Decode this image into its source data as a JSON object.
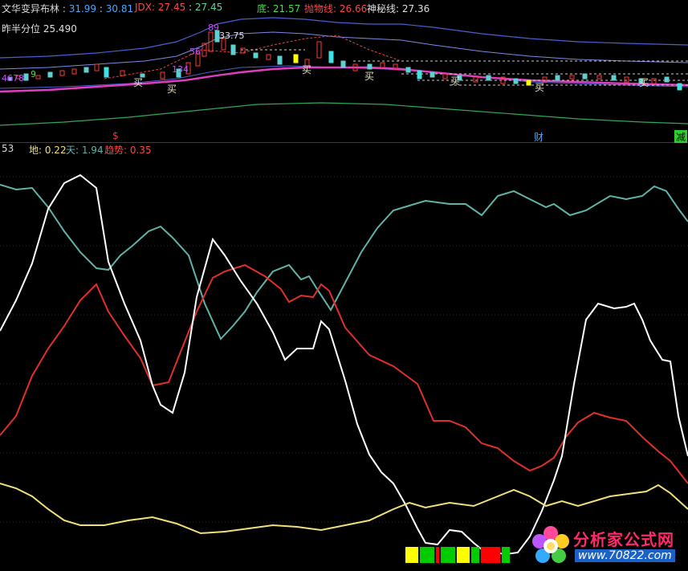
{
  "header": {
    "title": "文华变异布林",
    "v1": "31.99",
    "v2": "30.81",
    "jdx_label": "JDX: 27.45",
    "jdx_val": "27.45",
    "di_label": "底: 21.57",
    "pao_label": "抛物线: 26.66",
    "shen_label": "神秘线: 27.36"
  },
  "sub_header": {
    "zuoban_label": "昨半分位",
    "zuoban_value": "25.490"
  },
  "price_annotations": {
    "top_label_89": "89",
    "peak_price": "33.75",
    "label_56": "56",
    "label_134": "134",
    "left_seq": "4678",
    "left_9": "9",
    "buy": "买",
    "sell_dollar": "$",
    "cai": "财",
    "jian": "减"
  },
  "lower_header": {
    "left_num": "53",
    "di_label": "地: 0.22",
    "tian_label": "天: 1.94",
    "qushi_label": "趋势: 0.35"
  },
  "watermark": {
    "title": "分析家公式网",
    "url": "www.70822.com"
  },
  "colors": {
    "white_line": "#ffffff",
    "red_line": "#e8302a",
    "teal_line": "#5fb3a8",
    "yellow_line": "#f0e07a",
    "boll_upper": "#5a6fd8",
    "boll_mid": "#e03dbf",
    "green_line": "#2fa85a"
  },
  "signal_strip": [
    {
      "color": "#ffff00"
    },
    {
      "color": "#00cc00"
    },
    {
      "color": "#ff0000"
    },
    {
      "color": "#00cc00"
    },
    {
      "color": "#ffff00"
    },
    {
      "color": "#00cc00"
    },
    {
      "color": "#ff0000"
    },
    {
      "color": "#00cc00"
    }
  ]
}
